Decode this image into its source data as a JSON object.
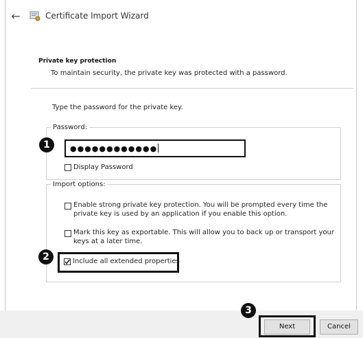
{
  "header": {
    "title": "Certificate Import Wizard"
  },
  "section": {
    "title": "Private key protection",
    "subtitle": "To maintain security, the private key was protected with a password."
  },
  "prompt": "Type the password for the private key.",
  "password_group": {
    "legend": "Password:",
    "value": "●●●●●●●●●●●●",
    "display_password_label": "Display Password"
  },
  "import_group": {
    "legend": "Import options:",
    "options": [
      {
        "line1": "Enable strong private key protection. You will be prompted every time the",
        "line2": "private key is used by an application if you enable this option.",
        "checked": false
      },
      {
        "line1": "Mark this key as exportable. This will allow you to back up or transport your",
        "line2": "keys at a later time.",
        "checked": false
      },
      {
        "line1": "Include all extended properties",
        "line2": "",
        "checked": true
      }
    ]
  },
  "callouts": [
    "1",
    "2",
    "3"
  ],
  "footer": {
    "next_label": "Next",
    "cancel_label": "Cancel"
  },
  "icons": {
    "back": "back-arrow-icon",
    "wizard": "certificate-icon",
    "check": "checkmark-icon"
  }
}
